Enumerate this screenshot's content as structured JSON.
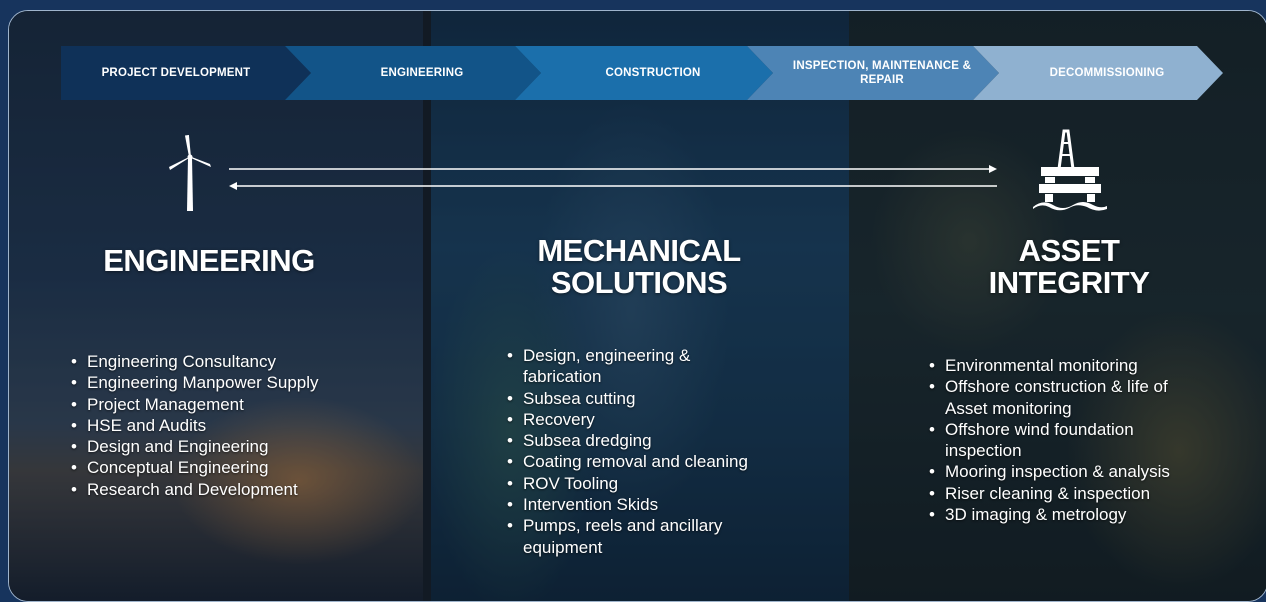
{
  "process_steps": [
    {
      "label": "PROJECT DEVELOPMENT"
    },
    {
      "label": "ENGINEERING"
    },
    {
      "label": "CONSTRUCTION"
    },
    {
      "label": "INSPECTION, MAINTENANCE & REPAIR"
    },
    {
      "label": "DECOMMISSIONING"
    }
  ],
  "icons": {
    "left": "wind-turbine-icon",
    "right": "offshore-rig-icon"
  },
  "columns": [
    {
      "heading": "ENGINEERING",
      "items": [
        "Engineering Consultancy",
        "Engineering Manpower Supply",
        "Project Management",
        "HSE and Audits",
        "Design and Engineering",
        "Conceptual Engineering",
        "Research and Development"
      ]
    },
    {
      "heading": "MECHANICAL SOLUTIONS",
      "items": [
        "Design, engineering & fabrication",
        "Subsea cutting",
        "Recovery",
        "Subsea dredging",
        "Coating removal and cleaning",
        "ROV Tooling",
        "Intervention Skids",
        "Pumps, reels and ancillary equipment"
      ]
    },
    {
      "heading": "ASSET INTEGRITY",
      "items": [
        "Environmental monitoring",
        "Offshore construction & life of Asset monitoring",
        "Offshore wind foundation inspection",
        "Mooring inspection & analysis",
        "Riser cleaning & inspection",
        "3D imaging & metrology"
      ]
    }
  ],
  "colors": {
    "step1": "#0f3158",
    "step2": "#125488",
    "step3": "#1b6fab",
    "step4": "#4d84b5",
    "step5": "#8fb1d0",
    "outer_background": "#17345d"
  }
}
